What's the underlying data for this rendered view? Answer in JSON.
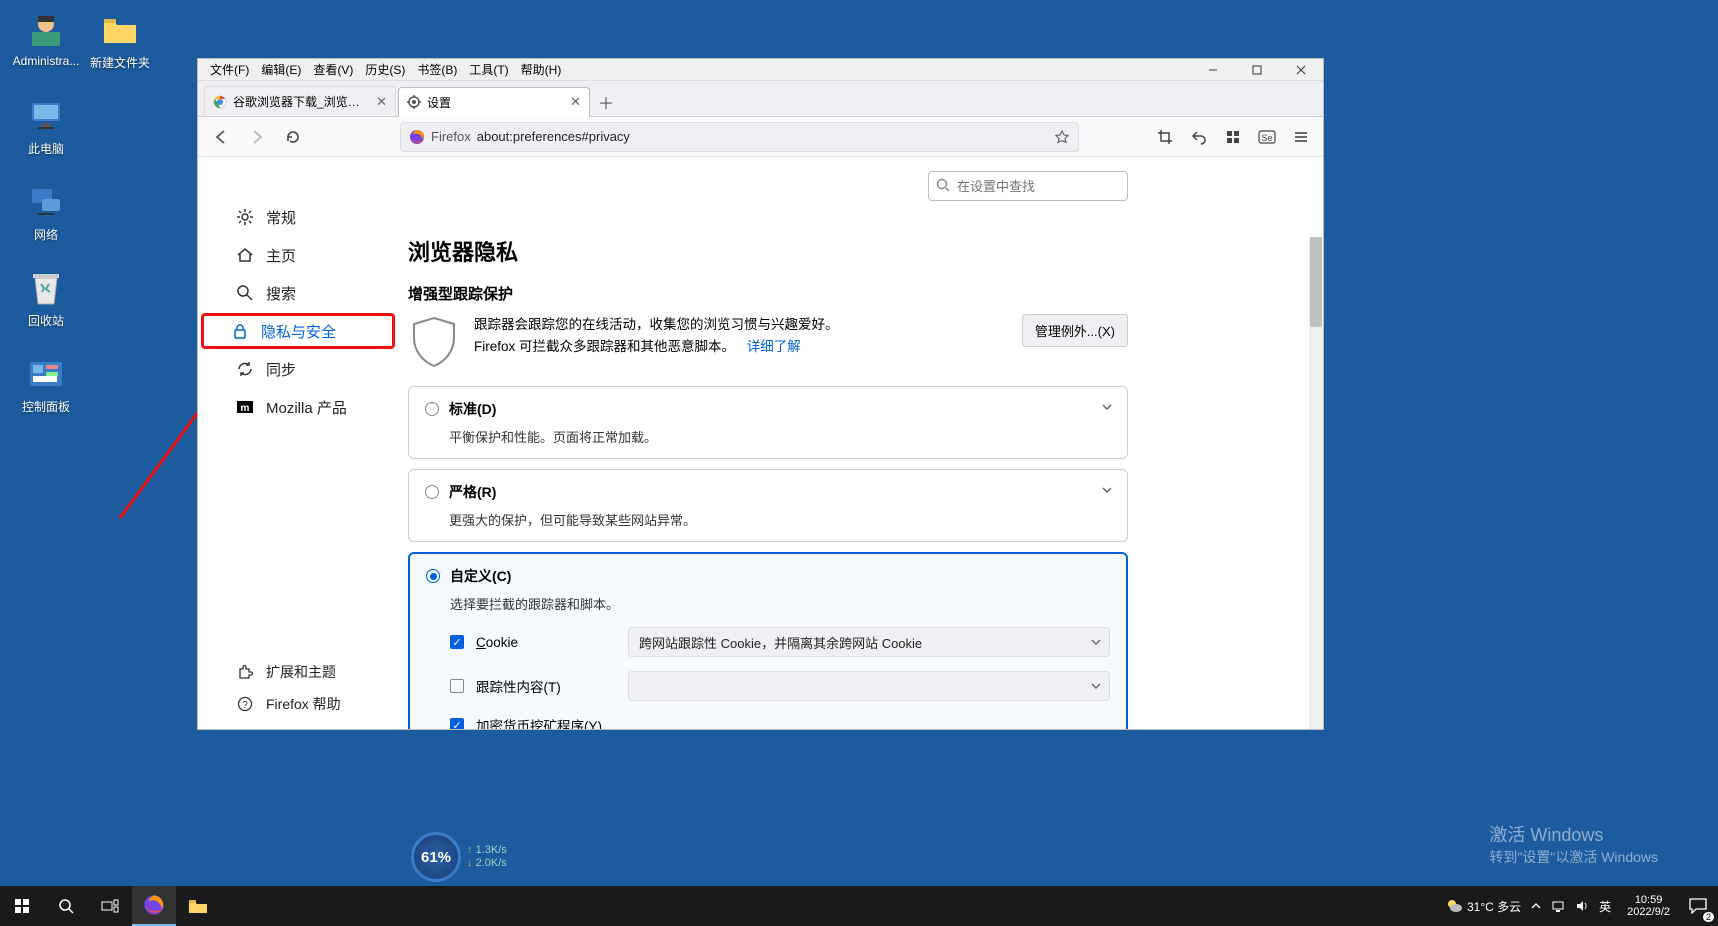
{
  "desktop": {
    "icons": [
      {
        "name": "admin",
        "label": "Administra..."
      },
      {
        "name": "newfolder",
        "label": "新建文件夹"
      },
      {
        "name": "thispc",
        "label": "此电脑"
      },
      {
        "name": "network",
        "label": "网络"
      },
      {
        "name": "recycle",
        "label": "回收站"
      },
      {
        "name": "controlpanel",
        "label": "控制面板"
      }
    ]
  },
  "menubar": [
    "文件(F)",
    "编辑(E)",
    "查看(V)",
    "历史(S)",
    "书签(B)",
    "工具(T)",
    "帮助(H)"
  ],
  "tabs": {
    "inactive_title": "谷歌浏览器下载_浏览器官网入口",
    "active_title": "设置"
  },
  "addr": {
    "brand": "Firefox",
    "url": "about:preferences#privacy"
  },
  "sidebar": {
    "general": "常规",
    "home": "主页",
    "search": "搜索",
    "privacy": "隐私与安全",
    "sync": "同步",
    "mozilla": "Mozilla 产品",
    "ext": "扩展和主题",
    "help": "Firefox 帮助"
  },
  "search_placeholder": "在设置中查找",
  "page": {
    "title": "浏览器隐私",
    "subtitle": "增强型跟踪保护",
    "desc_l1": "跟踪器会跟踪您的在线活动，收集您的浏览习惯与兴趣爱好。",
    "desc_l2": "Firefox 可拦截众多跟踪器和其他恶意脚本。",
    "learn_more": "详细了解",
    "manage": "管理例外...(X)",
    "opt_standard": "标准(D)",
    "opt_standard_desc": "平衡保护和性能。页面将正常加载。",
    "opt_strict": "严格(R)",
    "opt_strict_desc": "更强大的保护，但可能导致某些网站异常。",
    "opt_custom": "自定义(C)",
    "opt_custom_desc": "选择要拦截的跟踪器和脚本。",
    "cookie_label": "Cookie",
    "cookie_select": "跨网站跟踪性 Cookie，并隔离其余跨网站 Cookie",
    "tracking_label": "跟踪性内容(T)",
    "crypto_label": "加密货币挖矿程序(Y)"
  },
  "netmon": {
    "pct": "61%",
    "up": "1.3K/s",
    "dn": "2.0K/s"
  },
  "watermark": {
    "l1": "激活 Windows",
    "l2": "转到\"设置\"以激活 Windows"
  },
  "taskbar": {
    "weather": "31°C 多云",
    "ime": "英",
    "time": "10:59",
    "date": "2022/9/2",
    "notif_count": "2"
  }
}
